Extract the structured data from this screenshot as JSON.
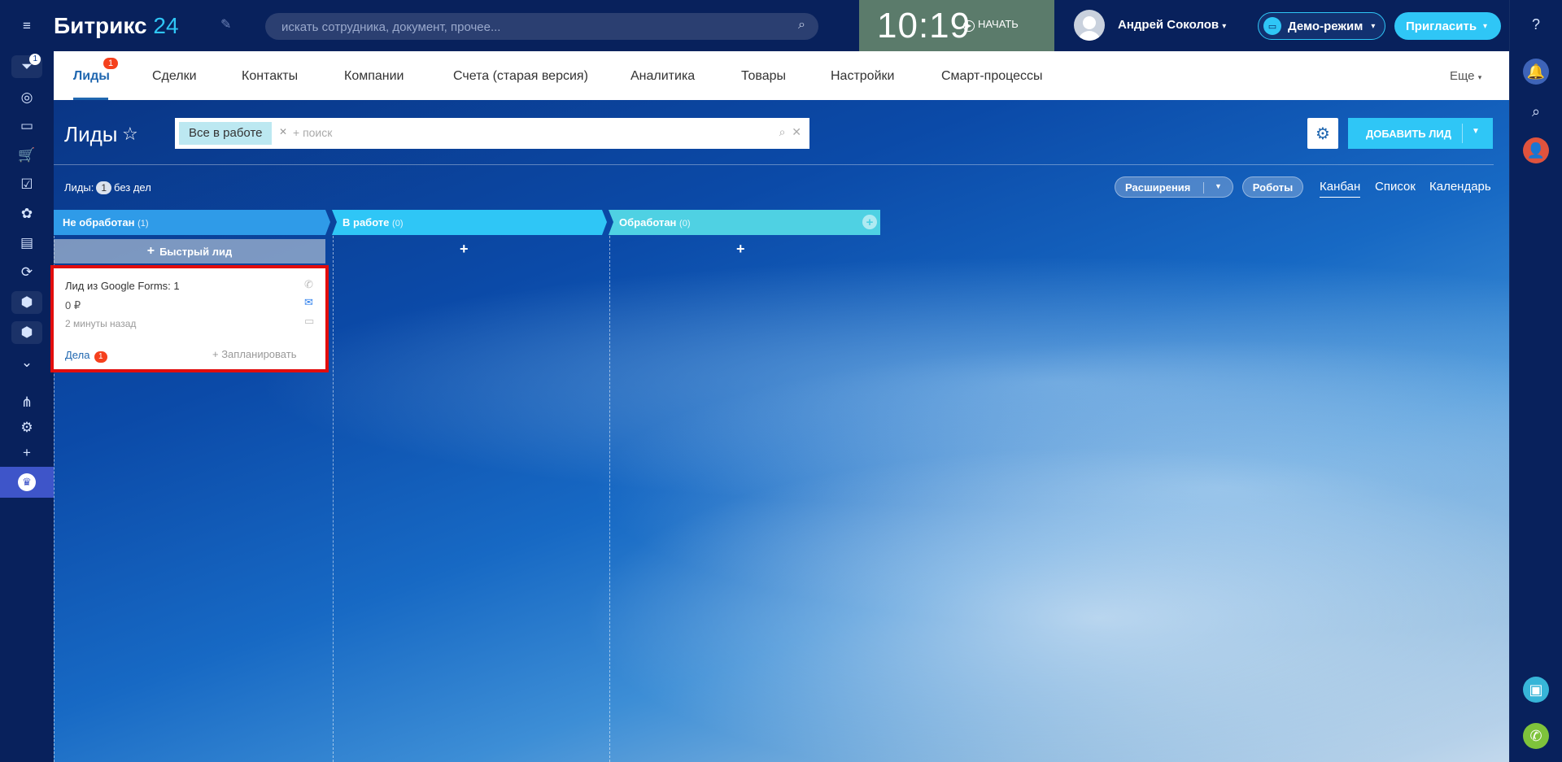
{
  "left_rail": {
    "items": [
      {
        "icon": "menu-icon"
      },
      {
        "icon": "filter-icon",
        "badge": "1"
      },
      {
        "icon": "target-icon"
      },
      {
        "icon": "calendar-icon"
      },
      {
        "icon": "cart-icon"
      },
      {
        "icon": "checkbox-icon"
      },
      {
        "icon": "network-icon"
      },
      {
        "icon": "contact-card-icon"
      },
      {
        "icon": "sync-icon"
      },
      {
        "icon": "box-icon"
      },
      {
        "icon": "box-icon"
      },
      {
        "icon": "chevron-down-icon"
      },
      {
        "icon": "sitemap-icon"
      },
      {
        "icon": "gear-icon"
      },
      {
        "icon": "plus-icon"
      },
      {
        "icon": "crown-icon"
      }
    ]
  },
  "header": {
    "brand": "Битрикс",
    "brand_num": "24",
    "search_placeholder": "искать сотрудника, документ, прочее...",
    "clock_time": "10:19",
    "clock_start": "НАЧАТЬ",
    "user_name": "Андрей Соколов",
    "demo_label": "Демо-режим",
    "invite_label": "Пригласить"
  },
  "tabs": [
    {
      "label": "Лиды",
      "active": true,
      "badge": "1"
    },
    {
      "label": "Сделки"
    },
    {
      "label": "Контакты"
    },
    {
      "label": "Компании"
    },
    {
      "label": "Счета (старая версия)"
    },
    {
      "label": "Аналитика"
    },
    {
      "label": "Товары"
    },
    {
      "label": "Настройки"
    },
    {
      "label": "Смарт-процессы"
    },
    {
      "label": "Еще"
    }
  ],
  "page": {
    "title": "Лиды",
    "filter_tag": "Все в работе",
    "filter_search_placeholder": "+ поиск",
    "add_lead": "ДОБАВИТЬ ЛИД",
    "summary_label": "Лиды:",
    "summary_count": "1",
    "summary_suffix": "без дел",
    "extensions": "Расширения",
    "robots": "Роботы",
    "views": [
      "Канбан",
      "Список",
      "Календарь"
    ]
  },
  "kanban": {
    "quick_lead": "Быстрый лид",
    "columns": [
      {
        "name": "Не обработан",
        "count": "(1)",
        "color": "#2f9be8"
      },
      {
        "name": "В работе",
        "count": "(0)",
        "color": "#2fc6f6"
      },
      {
        "name": "Обработан",
        "count": "(0)",
        "color": "#4dd0e1"
      }
    ],
    "card": {
      "title": "Лид из Google Forms: 1",
      "sum": "0 ₽",
      "time": "2 минуты назад",
      "deals": "Дела",
      "deals_count": "1",
      "plan": "+ Запланировать"
    }
  }
}
